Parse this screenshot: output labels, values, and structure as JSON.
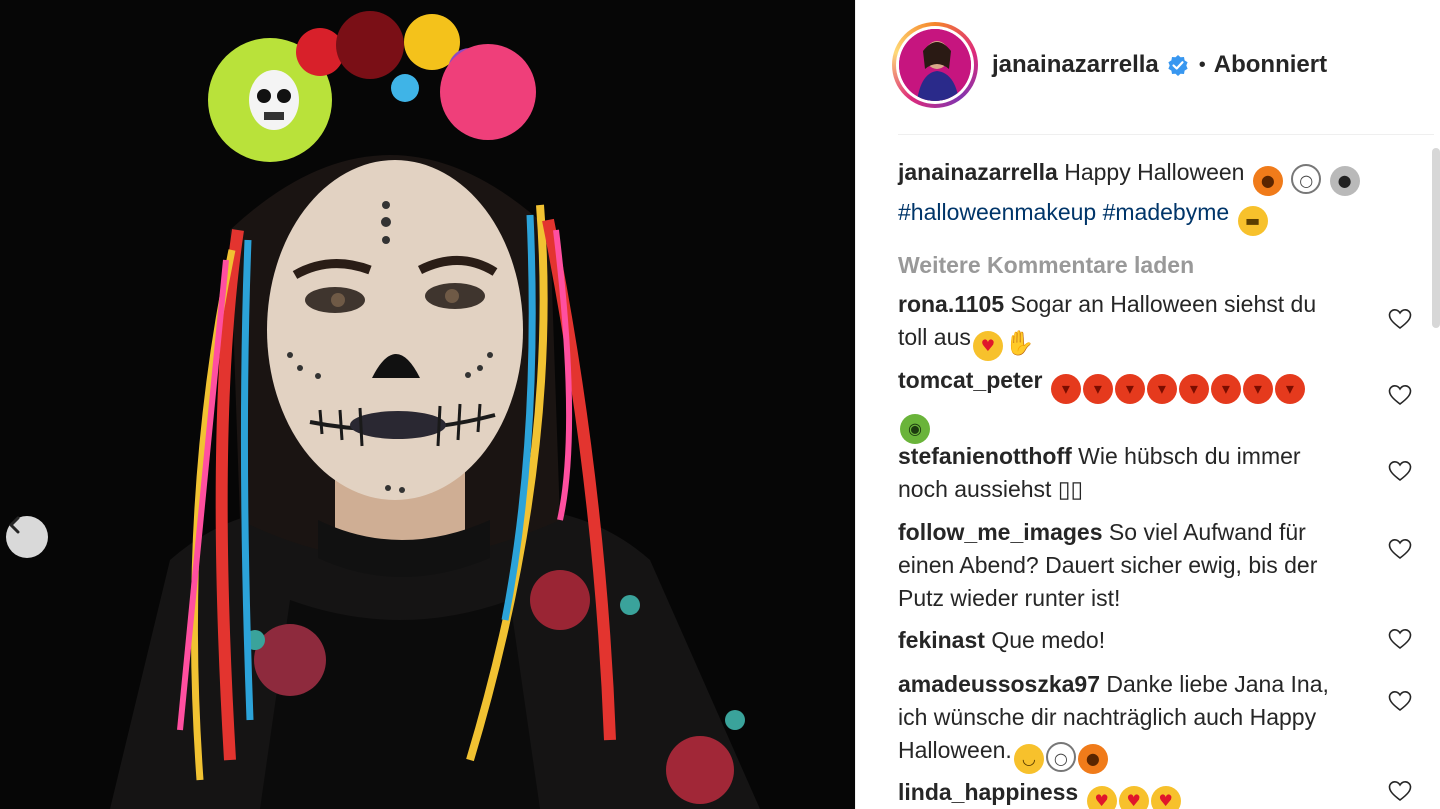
{
  "post": {
    "username": "janainazarrella",
    "follow_status": "Abonniert",
    "separator": "•"
  },
  "caption": {
    "username": "janainazarrella",
    "text": "Happy Halloween",
    "hashtags": "#halloweenmakeup #madebyme"
  },
  "load_more": "Weitere Kommentare laden",
  "comments": [
    {
      "username": "rona.1105",
      "text": "Sogar an Halloween siehst du toll aus"
    },
    {
      "username": "tomcat_peter",
      "text": ""
    },
    {
      "username": "stefanienotthoff",
      "text": "Wie hübsch du immer noch aussiehst ▯▯"
    },
    {
      "username": "follow_me_images",
      "text": "So viel Aufwand für einen Abend? Dauert sicher ewig, bis der Putz wieder runter ist!"
    },
    {
      "username": "fekinast",
      "text": "Que medo!"
    },
    {
      "username": "amadeussoszka97",
      "text": "Danke liebe Jana Ina, ich wünsche dir nachträglich auch Happy Halloween."
    },
    {
      "username": "linda_happiness",
      "text": ""
    }
  ],
  "icons": {
    "prev": "chevron-left-icon",
    "verified": "verified-badge-icon",
    "like": "heart-outline-icon"
  },
  "colors": {
    "hashtag": "#003569",
    "load_more": "#999999",
    "verified": "#3897f0"
  }
}
